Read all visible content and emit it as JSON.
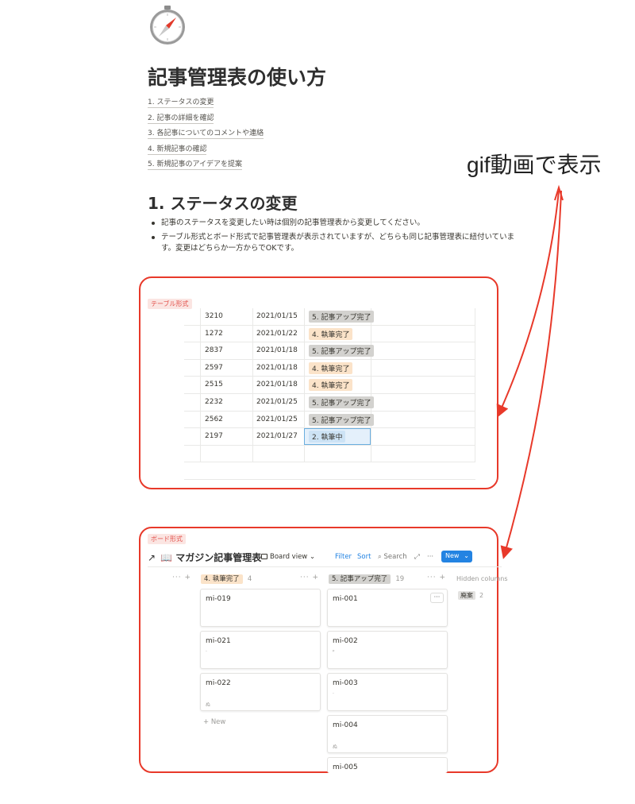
{
  "page": {
    "icon": "compass-icon",
    "title": "記事管理表の使い方"
  },
  "toc": [
    "1. ステータスの変更",
    "2. 記事の詳細を確認",
    "3. 各記事についてのコメントや連絡",
    "4. 新規記事の確認",
    "5. 新規記事のアイデアを提案"
  ],
  "annotation": {
    "text": "gif動画で表示"
  },
  "section1": {
    "heading": "1. ステータスの変更",
    "bullets": [
      "記事のステータスを変更したい時は個別の記事管理表から変更してください。",
      "テーブル形式とボード形式で記事管理表が表示されていますが、どちらも同じ記事管理表に紐付いています。変更はどちらか一方からでOKです。"
    ]
  },
  "table_view": {
    "label": "テーブル形式",
    "rows": [
      {
        "id": "3210",
        "date": "2021/01/15",
        "status": "5. 記事アップ完了",
        "status_color": "gray"
      },
      {
        "id": "1272",
        "date": "2021/01/22",
        "status": "4. 執筆完了",
        "status_color": "orange"
      },
      {
        "id": "2837",
        "date": "2021/01/18",
        "status": "5. 記事アップ完了",
        "status_color": "gray"
      },
      {
        "id": "2597",
        "date": "2021/01/18",
        "status": "4. 執筆完了",
        "status_color": "orange"
      },
      {
        "id": "2515",
        "date": "2021/01/18",
        "status": "4. 執筆完了",
        "status_color": "orange"
      },
      {
        "id": "2232",
        "date": "2021/01/25",
        "status": "5. 記事アップ完了",
        "status_color": "gray"
      },
      {
        "id": "2562",
        "date": "2021/01/25",
        "status": "5. 記事アップ完了",
        "status_color": "gray"
      },
      {
        "id": "2197",
        "date": "2021/01/27",
        "status": "2. 執筆中",
        "status_color": "blue"
      }
    ]
  },
  "board_view": {
    "label": "ボード形式",
    "title_arrow": "↗",
    "title_icon": "book-icon",
    "title": "マガジン記事管理表",
    "view_name": "Board view",
    "toolbar": {
      "filter": "Filter",
      "sort": "Sort",
      "search": "Search",
      "new": "New"
    },
    "columns": [
      {
        "name": "4. 執筆完了",
        "count": "4",
        "color": "orange",
        "cards": [
          "mi-019",
          "mi-021",
          "mi-022"
        ],
        "new_label": "+ New"
      },
      {
        "name": "5. 記事アップ完了",
        "count": "19",
        "color": "gray",
        "cards": [
          "mi-001",
          "mi-002",
          "mi-003",
          "mi-004",
          "mi-005"
        ]
      }
    ],
    "hidden": {
      "heading": "Hidden columns",
      "items": [
        {
          "name": "廃案",
          "count": "2"
        }
      ]
    }
  },
  "colors": {
    "highlight_frame": "#e8392a",
    "accent_blue": "#2383e2"
  }
}
